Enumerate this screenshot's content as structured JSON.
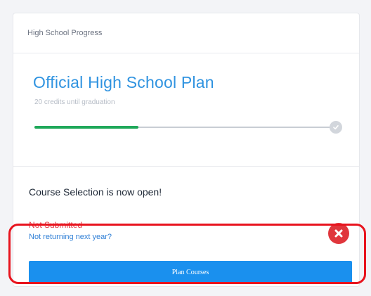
{
  "header": {
    "title": "High School Progress"
  },
  "plan": {
    "title": "Official High School Plan",
    "subtitle": "20 credits until graduation",
    "progress_fraction": 0.35,
    "complete_icon": "check-icon"
  },
  "course_selection": {
    "title": "Course Selection is now open!",
    "status": "Not Submitted",
    "not_returning_link": "Not returning next year?",
    "status_icon": "close-icon",
    "plan_button_label": "Plan Courses"
  },
  "colors": {
    "accent": "#1a90ee",
    "title_blue": "#2f93e0",
    "progress_green": "#1fa85a",
    "status_red": "#e53945",
    "highlight_red": "#e8141e"
  }
}
